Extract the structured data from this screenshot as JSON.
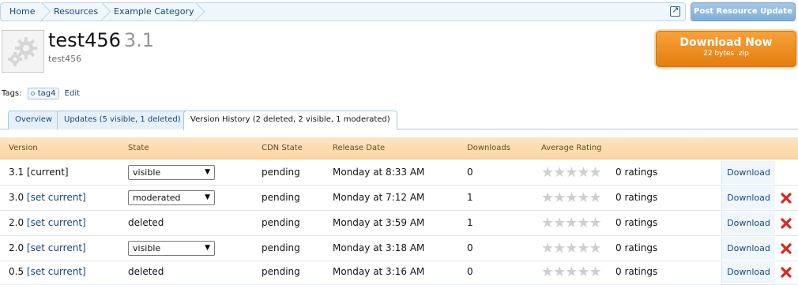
{
  "breadcrumb": {
    "items": [
      "Home",
      "Resources",
      "Example Category"
    ]
  },
  "post_update_label": "Post Resource Update",
  "resource": {
    "title": "test456",
    "version": "3.1",
    "tagline": "test456"
  },
  "download_now": {
    "label": "Download Now",
    "sub": "22 bytes .zip"
  },
  "tags": {
    "label": "Tags:",
    "items": [
      "tag4"
    ],
    "edit": "Edit"
  },
  "tabs": [
    {
      "label": "Overview",
      "active": false
    },
    {
      "label": "Updates (5 visible, 1 deleted)",
      "active": false
    },
    {
      "label": "Version History (2 deleted, 2 visible, 1 moderated)",
      "active": true
    }
  ],
  "table": {
    "columns": [
      "Version",
      "State",
      "CDN State",
      "Release Date",
      "Downloads",
      "Average Rating"
    ],
    "rows": [
      {
        "version": "3.1",
        "version_action": "[current]",
        "state": "visible",
        "state_is_select": true,
        "cdn": "pending",
        "date": "Monday at 8:33 AM",
        "downloads": "0",
        "rating": "0 ratings",
        "download": "Download",
        "deletable": false
      },
      {
        "version": "3.0",
        "version_action": "[set current]",
        "state": "moderated",
        "state_is_select": true,
        "cdn": "pending",
        "date": "Monday at 7:12 AM",
        "downloads": "1",
        "rating": "0 ratings",
        "download": "Download",
        "deletable": true
      },
      {
        "version": "2.0",
        "version_action": "[set current]",
        "state": "deleted",
        "state_is_select": false,
        "cdn": "pending",
        "date": "Monday at 3:59 AM",
        "downloads": "1",
        "rating": "0 ratings",
        "download": "Download",
        "deletable": true
      },
      {
        "version": "2.0",
        "version_action": "[set current]",
        "state": "visible",
        "state_is_select": true,
        "cdn": "pending",
        "date": "Monday at 3:18 AM",
        "downloads": "0",
        "rating": "0 ratings",
        "download": "Download",
        "deletable": true
      },
      {
        "version": "0.5",
        "version_action": "[set current]",
        "state": "deleted",
        "state_is_select": false,
        "cdn": "pending",
        "date": "Monday at 3:16 AM",
        "downloads": "0",
        "rating": "0 ratings",
        "download": "Download",
        "deletable": true
      }
    ]
  },
  "colors": {
    "link": "#16487c",
    "header_bg": "#fbd5a2",
    "download_orange": "#e47d0f",
    "delete_red": "#d9261c"
  }
}
